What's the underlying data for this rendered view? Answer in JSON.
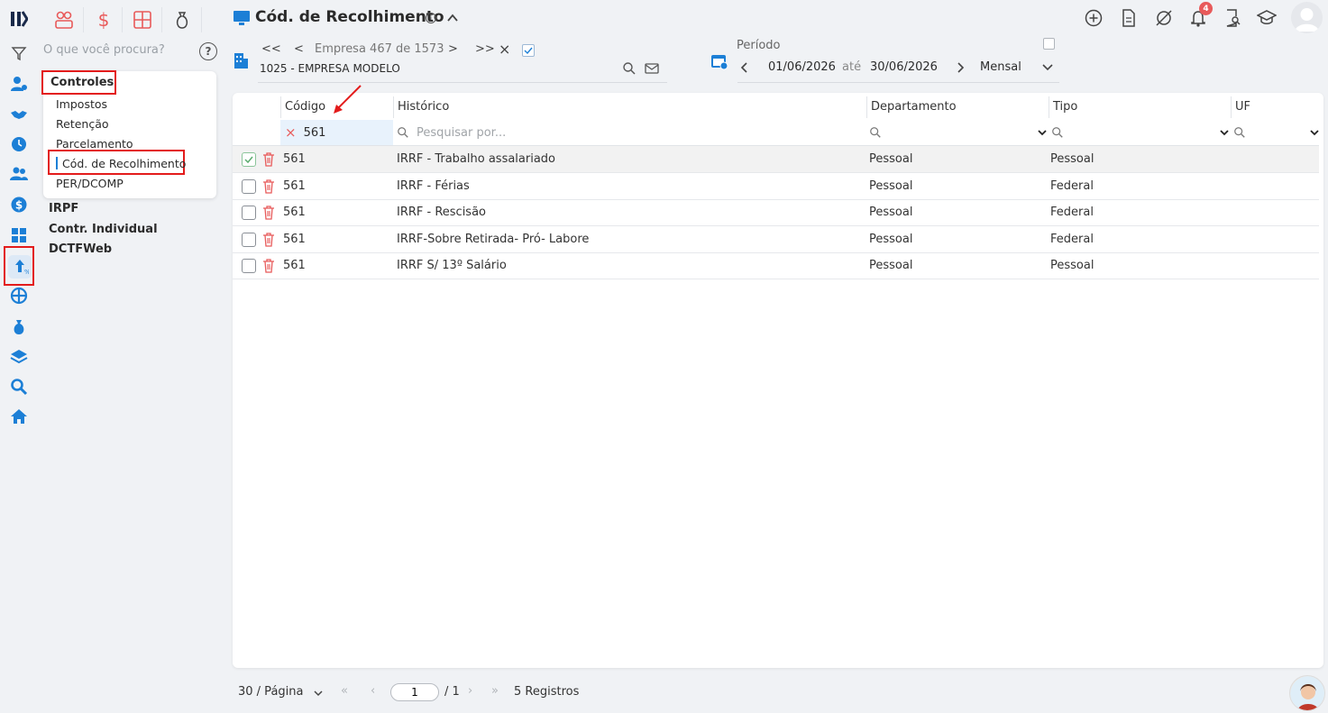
{
  "app": {
    "title": "Cód. de Recolhimento"
  },
  "sidebar": {
    "search_placeholder": "O que você procura?",
    "help": "?",
    "submenu": {
      "heading": "Controles",
      "items": [
        "Impostos",
        "Retenção",
        "Parcelamento",
        "Cód. de Recolhimento",
        "PER/DCOMP"
      ],
      "active": "Cód. de Recolhimento"
    },
    "groups": [
      "IRPF",
      "Contr. Individual",
      "DCTFWeb"
    ]
  },
  "header": {
    "notifications_count": "4"
  },
  "empresa": {
    "first": "<<",
    "prev": "<",
    "label": "Empresa 467 de 1573",
    "next": ">",
    "last": ">>",
    "clear": "×",
    "name": "1025 - EMPRESA MODELO"
  },
  "periodo": {
    "label": "Período",
    "start": "01/06/2026",
    "sep": "até",
    "end": "30/06/2026",
    "mode": "Mensal"
  },
  "table": {
    "columns": [
      "Código",
      "Histórico",
      "Departamento",
      "Tipo",
      "UF"
    ],
    "filters": {
      "codigo": "561",
      "historico_placeholder": "Pesquisar por..."
    },
    "rows": [
      {
        "codigo": "561",
        "historico": "IRRF - Trabalho assalariado",
        "departamento": "Pessoal",
        "tipo": "Pessoal",
        "uf": "",
        "checked": true
      },
      {
        "codigo": "561",
        "historico": "IRRF - Férias",
        "departamento": "Pessoal",
        "tipo": "Federal",
        "uf": "",
        "checked": false
      },
      {
        "codigo": "561",
        "historico": "IRRF - Rescisão",
        "departamento": "Pessoal",
        "tipo": "Federal",
        "uf": "",
        "checked": false
      },
      {
        "codigo": "561",
        "historico": "IRRF-Sobre Retirada- Pró- Labore",
        "departamento": "Pessoal",
        "tipo": "Federal",
        "uf": "",
        "checked": false
      },
      {
        "codigo": "561",
        "historico": "IRRF S/ 13º Salário",
        "departamento": "Pessoal",
        "tipo": "Pessoal",
        "uf": "",
        "checked": false
      }
    ]
  },
  "footer": {
    "page_size": "30 / Página",
    "page": "1",
    "total_pages": "/ 1",
    "records": "5 Registros"
  },
  "colors": {
    "accent_red": "#e31b1b",
    "brand_blue": "#1c7fd6",
    "icon_red": "#e85a5a"
  }
}
